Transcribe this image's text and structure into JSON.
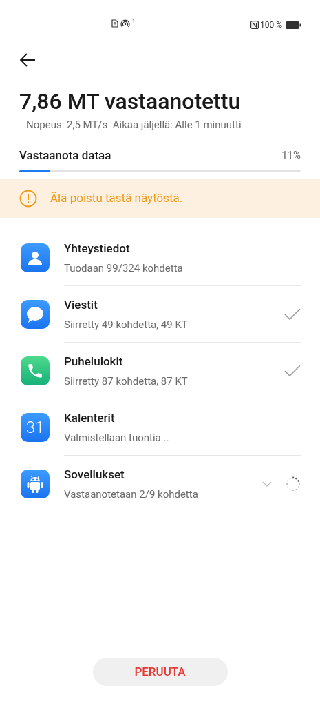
{
  "status_bar": {
    "hotspot_sup": "1",
    "battery": "100 %"
  },
  "title": "7,86 MT vastaanotettu",
  "subtitle": "Nopeus: 2,5 MT/s  Aikaa jäljellä: Alle 1 minuutti",
  "progress": {
    "label": "Vastaanota dataa",
    "reading": "11%",
    "level": 0.11
  },
  "warning": "Älä poistu tästä näytöstä.",
  "items": [
    {
      "name": "Yhteystiedot",
      "detail": "Tuodaan 99/324 kohdetta",
      "kind": "plain"
    },
    {
      "name": "Viestit",
      "detail": "Siirretty 49 kohdetta, 49 KT",
      "kind": "done"
    },
    {
      "name": "Puhelulokit",
      "detail": "Siirretty 87 kohdetta, 87 KT",
      "kind": "done"
    },
    {
      "icon_text": "31",
      "name": "Kalenterit",
      "detail": "Valmistellaan tuontia...",
      "kind": "plain"
    },
    {
      "name": "Sovellukset",
      "detail": "Vastaanotetaan 2/9 kohdetta",
      "kind": "loading"
    }
  ],
  "cancel_button": "PERUUTA"
}
